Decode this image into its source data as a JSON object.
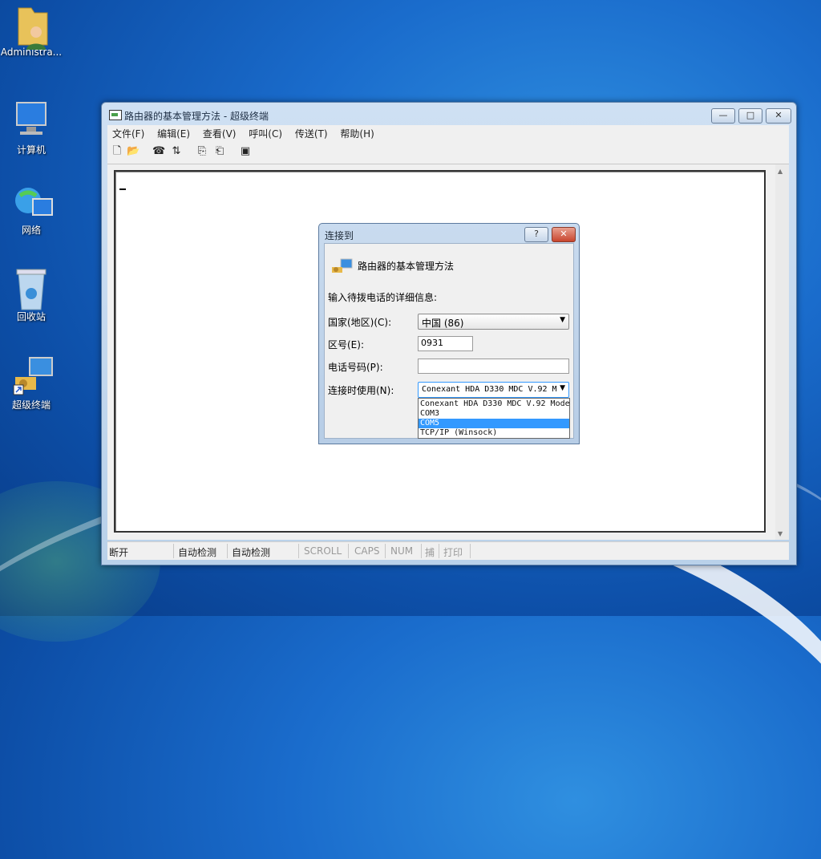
{
  "desktop": {
    "icons": [
      {
        "label": "Administra...",
        "icon": "user-folder-icon"
      },
      {
        "label": "计算机",
        "icon": "computer-icon"
      },
      {
        "label": "网络",
        "icon": "network-icon"
      },
      {
        "label": "回收站",
        "icon": "recycle-bin-icon"
      },
      {
        "label": "超级终端",
        "icon": "hyperterminal-icon"
      }
    ]
  },
  "window": {
    "title": "路由器的基本管理方法 - 超级终端",
    "menu": [
      "文件(F)",
      "编辑(E)",
      "查看(V)",
      "呼叫(C)",
      "传送(T)",
      "帮助(H)"
    ],
    "toolbar": [
      "new-icon",
      "open-icon",
      "connect-icon",
      "disconnect-icon",
      "send-icon",
      "receive-icon",
      "properties-icon"
    ],
    "status": [
      "断开",
      "自动检测",
      "自动检测",
      "SCROLL",
      "CAPS",
      "NUM",
      "捕",
      "打印"
    ],
    "controls": {
      "minimize": "—",
      "maximize": "□",
      "close": "✕"
    }
  },
  "dialog": {
    "title": "连接到",
    "help_btn": "?",
    "close_btn": "✕",
    "connection_name": "路由器的基本管理方法",
    "prompt": "输入待拨电话的详细信息:",
    "country_label": "国家(地区)(C):",
    "country_value": "中国 (86)",
    "area_label": "区号(E):",
    "area_value": "0931",
    "phone_label": "电话号码(P):",
    "phone_value": "",
    "connect_label": "连接时使用(N):",
    "connect_value": "Conexant HDA D330 MDC V.92 M",
    "options": [
      "Conexant HDA D330 MDC V.92 Mode",
      "COM3",
      "COM5",
      "TCP/IP (Winsock)"
    ],
    "selected_index": 2
  },
  "colors": {
    "selection": "#3399ff",
    "desktop": "#1a6ccc"
  }
}
